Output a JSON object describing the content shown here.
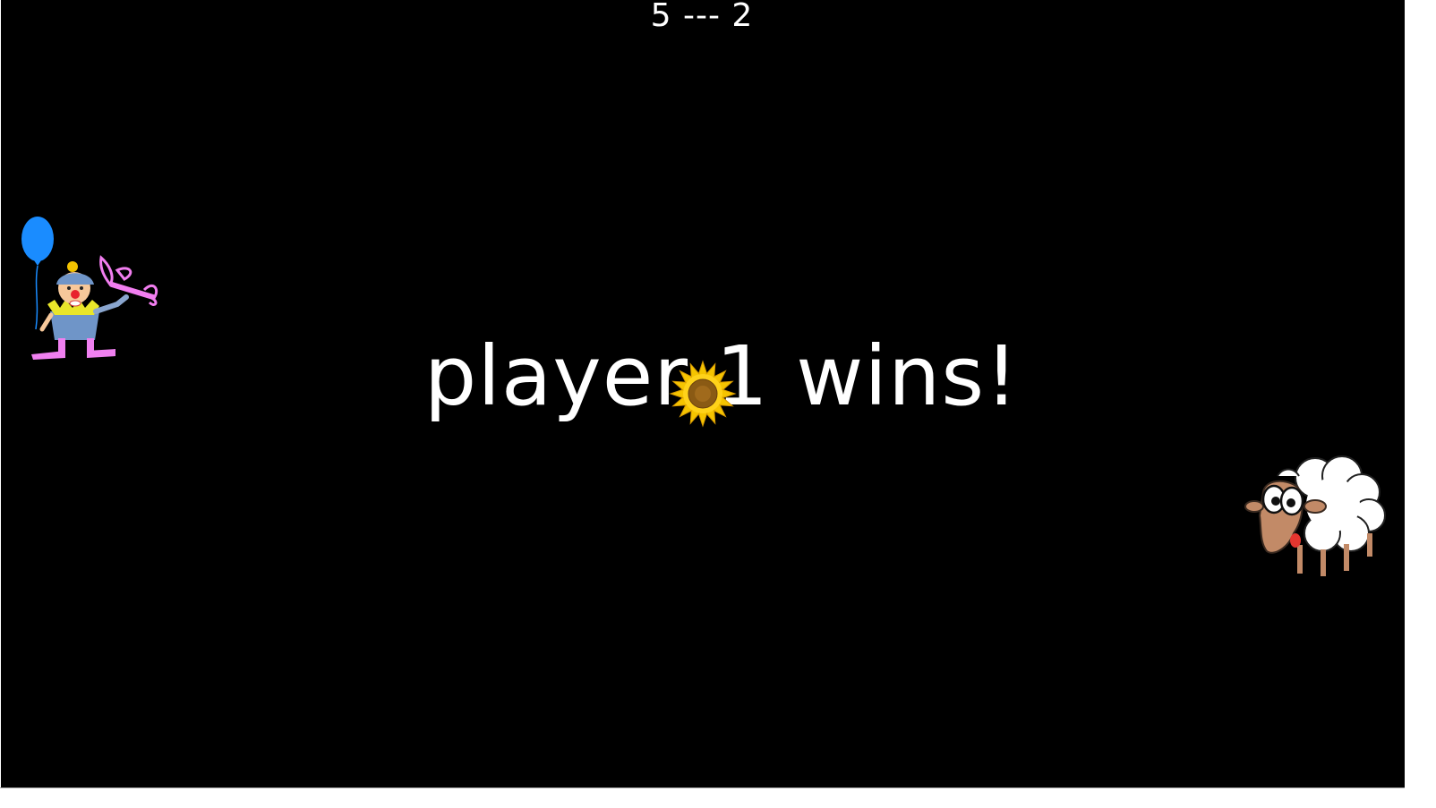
{
  "scoreboard": {
    "text": "5 --- 2"
  },
  "result": {
    "message": "player 1 wins!"
  },
  "sprites": {
    "player1": "clown-with-balloon-and-toy-plane",
    "player2": "cartoon-sheep",
    "ball": "sunflower"
  },
  "colors": {
    "background": "#000000",
    "text": "#ffffff",
    "balloon": "#1a8cff",
    "sunflower_petals": "#f5c400",
    "sheep_wool": "#ffffff"
  }
}
